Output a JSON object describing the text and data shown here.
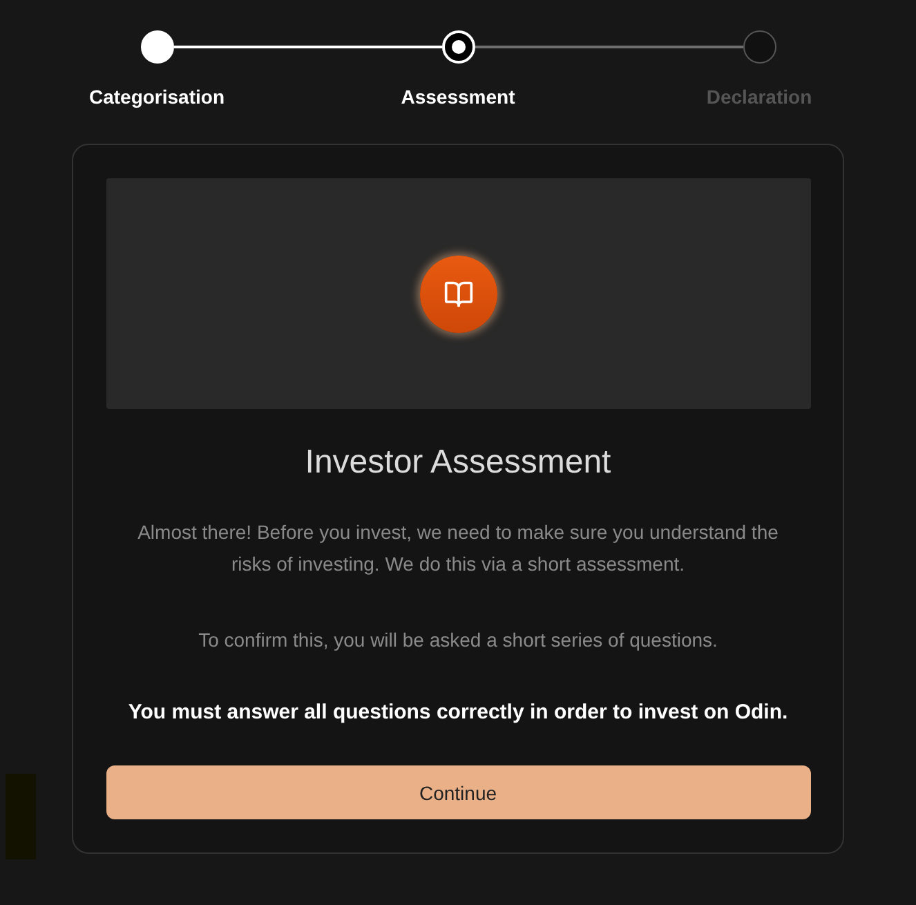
{
  "stepper": {
    "steps": [
      {
        "label": "Categorisation",
        "completed": true,
        "selected": false
      },
      {
        "label": "Assessment",
        "completed": false,
        "selected": true
      },
      {
        "label": "Declaration",
        "completed": false,
        "selected": false
      }
    ]
  },
  "card": {
    "title": "Investor Assessment",
    "paragraphs": [
      "Almost there! Before you invest, we need to make sure you understand the risks of investing. We do this via a short assessment.",
      "To confirm this, you will be asked a short series of questions."
    ],
    "notice": "You must answer all questions correctly in order to invest on Odin.",
    "button": "Continue"
  }
}
